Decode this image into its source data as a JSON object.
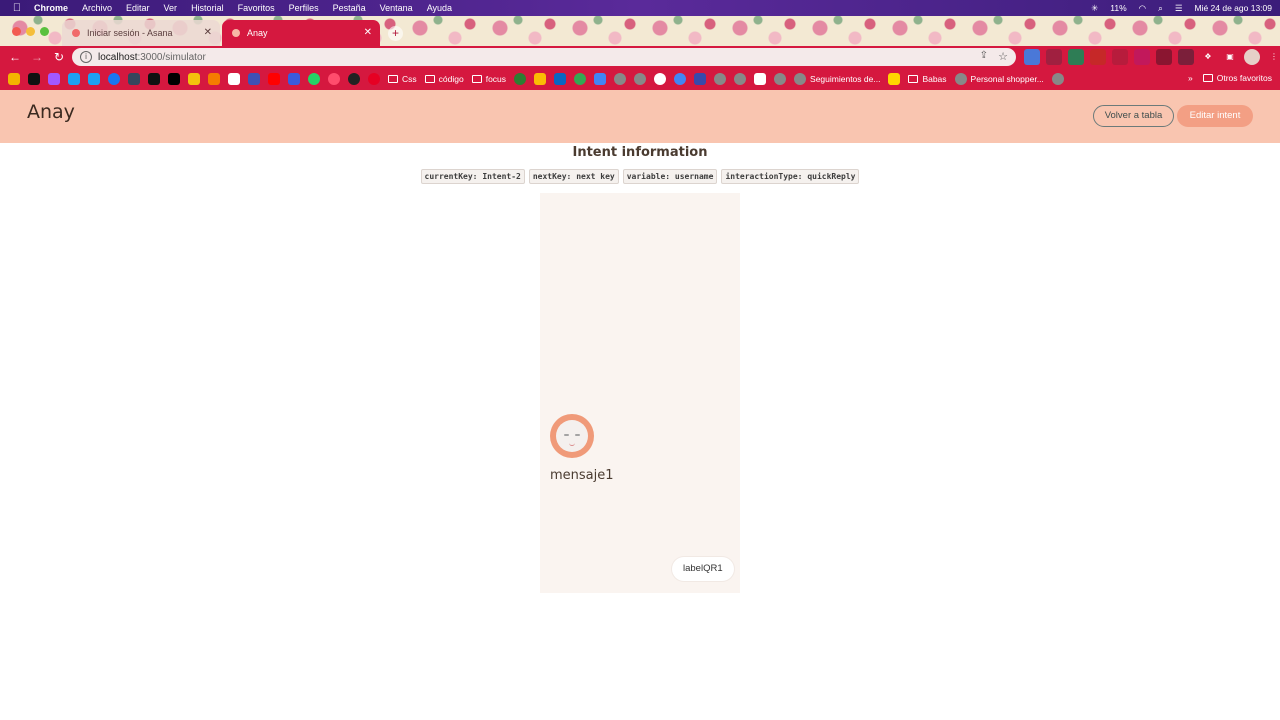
{
  "os_menubar": {
    "app": "Chrome",
    "items": [
      "Archivo",
      "Editar",
      "Ver",
      "Historial",
      "Favoritos",
      "Perfiles",
      "Pestaña",
      "Ventana",
      "Ayuda"
    ],
    "battery": "11%",
    "datetime": "Mié 24 de ago  13:09"
  },
  "browser": {
    "tabs": [
      {
        "title": "Iniciar sesión - Asana",
        "active": false
      },
      {
        "title": "Anay",
        "active": true
      }
    ],
    "url_host": "localhost",
    "url_path": ":3000/simulator",
    "bookmarks": {
      "folders": [
        "Css",
        "código",
        "focus"
      ],
      "links": [
        "Seguimientos de...",
        "Babas",
        "Personal shopper..."
      ],
      "overflow": "»",
      "other_folder": "Otros favoritos"
    }
  },
  "app": {
    "title": "Anay",
    "back_button": "Volver a tabla",
    "edit_button": "Editar intent"
  },
  "intent": {
    "heading": "Intent information",
    "tags": [
      "currentKey: Intent-2",
      "nextKey: next key",
      "variable: username",
      "interactionType: quickReply"
    ]
  },
  "simulator": {
    "message": "mensaje1",
    "quick_reply": "labelQR1"
  },
  "colors": {
    "browser_accent": "#d5183f",
    "app_header": "#f9c5b0",
    "primary_button": "#f39f84",
    "simulator_bg": "#faf4f0",
    "avatar_ring": "#f09a79"
  }
}
